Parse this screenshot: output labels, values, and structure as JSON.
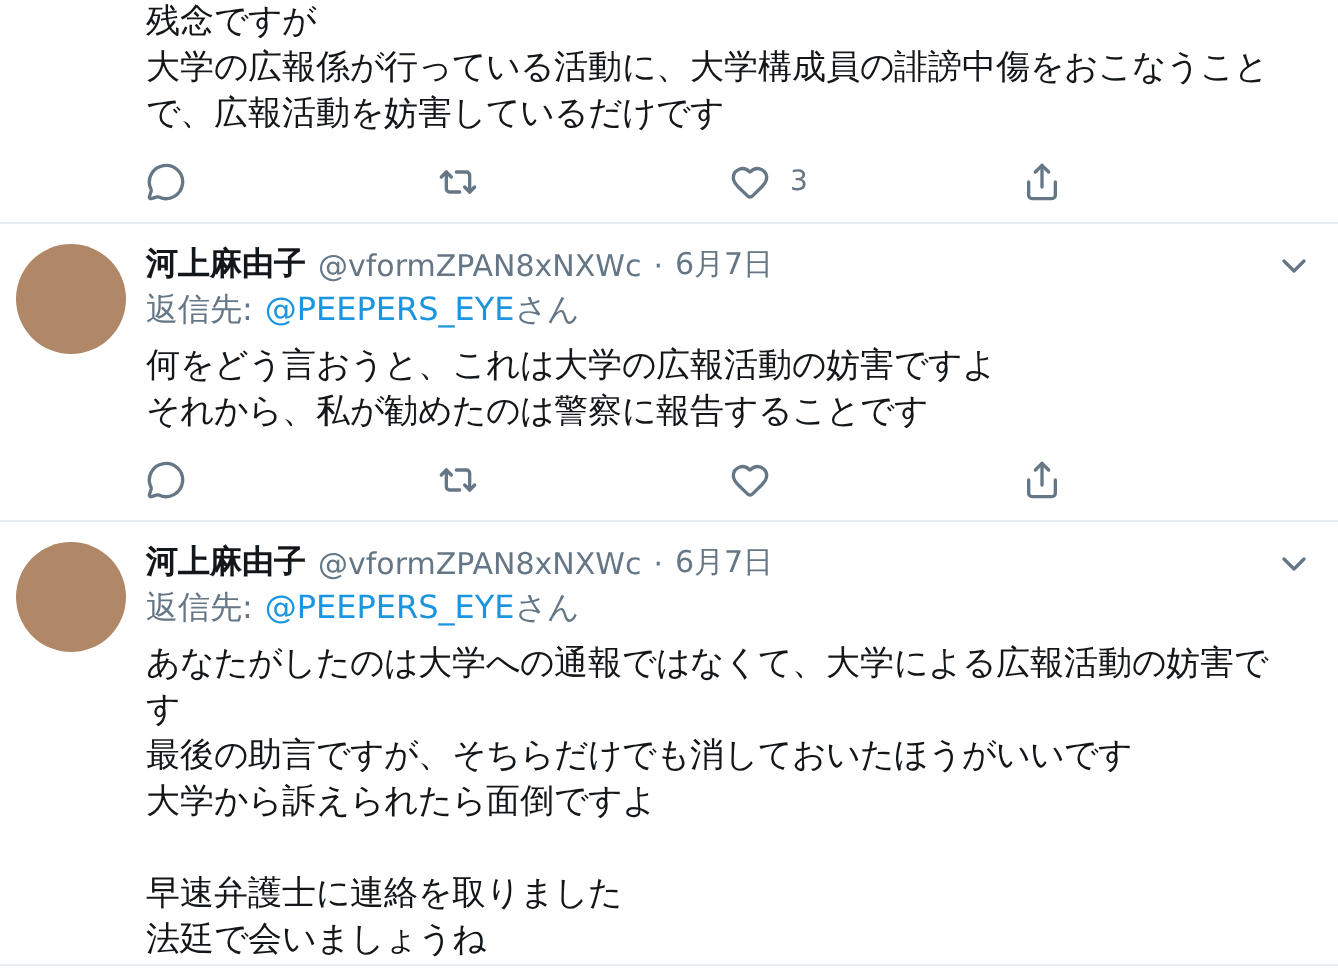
{
  "tweets": [
    {
      "paragraphs": [
        [
          "残念ですが",
          "大学の広報係が行っている活動に、大学構成員の誹謗中傷をおこなうことで、広報活動を妨害しているだけです"
        ]
      ],
      "action_bar": true,
      "like_count": "3"
    },
    {
      "author": {
        "name": "河上麻由子",
        "handle": "@vformZPAN8xNXWc",
        "separator": "·",
        "date": "6月7日",
        "reply_label": "返信先:",
        "reply_to": "@PEEPERS_EYE",
        "reply_suffix": "さん"
      },
      "paragraphs": [
        [
          "何をどう言おうと、これは大学の広報活動の妨害ですよ",
          "それから、私が勧めたのは警察に報告することです"
        ]
      ],
      "action_bar": true
    },
    {
      "author": {
        "name": "河上麻由子",
        "handle": "@vformZPAN8xNXWc",
        "separator": "·",
        "date": "6月7日",
        "reply_label": "返信先:",
        "reply_to": "@PEEPERS_EYE",
        "reply_suffix": "さん"
      },
      "paragraphs": [
        [
          "あなたがしたのは大学への通報ではなくて、大学による広報活動の妨害です",
          "最後の助言ですが、そちらだけでも消しておいたほうがいいです",
          "大学から訴えられたら面倒ですよ"
        ],
        [
          "早速弁護士に連絡を取りました",
          "法廷で会いましょうね"
        ]
      ],
      "action_bar": false
    }
  ]
}
